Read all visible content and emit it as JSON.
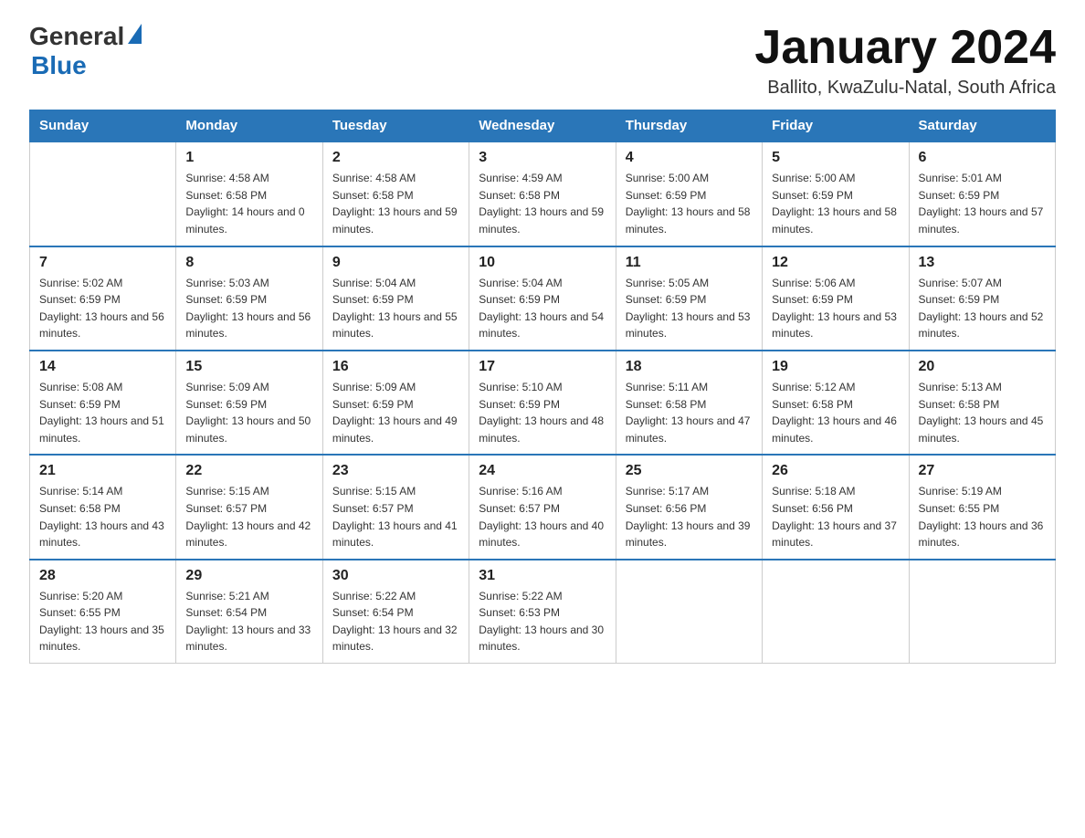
{
  "logo": {
    "general": "General",
    "blue": "Blue"
  },
  "title": "January 2024",
  "location": "Ballito, KwaZulu-Natal, South Africa",
  "days_of_week": [
    "Sunday",
    "Monday",
    "Tuesday",
    "Wednesday",
    "Thursday",
    "Friday",
    "Saturday"
  ],
  "weeks": [
    [
      {
        "day": "",
        "sunrise": "",
        "sunset": "",
        "daylight": ""
      },
      {
        "day": "1",
        "sunrise": "Sunrise: 4:58 AM",
        "sunset": "Sunset: 6:58 PM",
        "daylight": "Daylight: 14 hours and 0 minutes."
      },
      {
        "day": "2",
        "sunrise": "Sunrise: 4:58 AM",
        "sunset": "Sunset: 6:58 PM",
        "daylight": "Daylight: 13 hours and 59 minutes."
      },
      {
        "day": "3",
        "sunrise": "Sunrise: 4:59 AM",
        "sunset": "Sunset: 6:58 PM",
        "daylight": "Daylight: 13 hours and 59 minutes."
      },
      {
        "day": "4",
        "sunrise": "Sunrise: 5:00 AM",
        "sunset": "Sunset: 6:59 PM",
        "daylight": "Daylight: 13 hours and 58 minutes."
      },
      {
        "day": "5",
        "sunrise": "Sunrise: 5:00 AM",
        "sunset": "Sunset: 6:59 PM",
        "daylight": "Daylight: 13 hours and 58 minutes."
      },
      {
        "day": "6",
        "sunrise": "Sunrise: 5:01 AM",
        "sunset": "Sunset: 6:59 PM",
        "daylight": "Daylight: 13 hours and 57 minutes."
      }
    ],
    [
      {
        "day": "7",
        "sunrise": "Sunrise: 5:02 AM",
        "sunset": "Sunset: 6:59 PM",
        "daylight": "Daylight: 13 hours and 56 minutes."
      },
      {
        "day": "8",
        "sunrise": "Sunrise: 5:03 AM",
        "sunset": "Sunset: 6:59 PM",
        "daylight": "Daylight: 13 hours and 56 minutes."
      },
      {
        "day": "9",
        "sunrise": "Sunrise: 5:04 AM",
        "sunset": "Sunset: 6:59 PM",
        "daylight": "Daylight: 13 hours and 55 minutes."
      },
      {
        "day": "10",
        "sunrise": "Sunrise: 5:04 AM",
        "sunset": "Sunset: 6:59 PM",
        "daylight": "Daylight: 13 hours and 54 minutes."
      },
      {
        "day": "11",
        "sunrise": "Sunrise: 5:05 AM",
        "sunset": "Sunset: 6:59 PM",
        "daylight": "Daylight: 13 hours and 53 minutes."
      },
      {
        "day": "12",
        "sunrise": "Sunrise: 5:06 AM",
        "sunset": "Sunset: 6:59 PM",
        "daylight": "Daylight: 13 hours and 53 minutes."
      },
      {
        "day": "13",
        "sunrise": "Sunrise: 5:07 AM",
        "sunset": "Sunset: 6:59 PM",
        "daylight": "Daylight: 13 hours and 52 minutes."
      }
    ],
    [
      {
        "day": "14",
        "sunrise": "Sunrise: 5:08 AM",
        "sunset": "Sunset: 6:59 PM",
        "daylight": "Daylight: 13 hours and 51 minutes."
      },
      {
        "day": "15",
        "sunrise": "Sunrise: 5:09 AM",
        "sunset": "Sunset: 6:59 PM",
        "daylight": "Daylight: 13 hours and 50 minutes."
      },
      {
        "day": "16",
        "sunrise": "Sunrise: 5:09 AM",
        "sunset": "Sunset: 6:59 PM",
        "daylight": "Daylight: 13 hours and 49 minutes."
      },
      {
        "day": "17",
        "sunrise": "Sunrise: 5:10 AM",
        "sunset": "Sunset: 6:59 PM",
        "daylight": "Daylight: 13 hours and 48 minutes."
      },
      {
        "day": "18",
        "sunrise": "Sunrise: 5:11 AM",
        "sunset": "Sunset: 6:58 PM",
        "daylight": "Daylight: 13 hours and 47 minutes."
      },
      {
        "day": "19",
        "sunrise": "Sunrise: 5:12 AM",
        "sunset": "Sunset: 6:58 PM",
        "daylight": "Daylight: 13 hours and 46 minutes."
      },
      {
        "day": "20",
        "sunrise": "Sunrise: 5:13 AM",
        "sunset": "Sunset: 6:58 PM",
        "daylight": "Daylight: 13 hours and 45 minutes."
      }
    ],
    [
      {
        "day": "21",
        "sunrise": "Sunrise: 5:14 AM",
        "sunset": "Sunset: 6:58 PM",
        "daylight": "Daylight: 13 hours and 43 minutes."
      },
      {
        "day": "22",
        "sunrise": "Sunrise: 5:15 AM",
        "sunset": "Sunset: 6:57 PM",
        "daylight": "Daylight: 13 hours and 42 minutes."
      },
      {
        "day": "23",
        "sunrise": "Sunrise: 5:15 AM",
        "sunset": "Sunset: 6:57 PM",
        "daylight": "Daylight: 13 hours and 41 minutes."
      },
      {
        "day": "24",
        "sunrise": "Sunrise: 5:16 AM",
        "sunset": "Sunset: 6:57 PM",
        "daylight": "Daylight: 13 hours and 40 minutes."
      },
      {
        "day": "25",
        "sunrise": "Sunrise: 5:17 AM",
        "sunset": "Sunset: 6:56 PM",
        "daylight": "Daylight: 13 hours and 39 minutes."
      },
      {
        "day": "26",
        "sunrise": "Sunrise: 5:18 AM",
        "sunset": "Sunset: 6:56 PM",
        "daylight": "Daylight: 13 hours and 37 minutes."
      },
      {
        "day": "27",
        "sunrise": "Sunrise: 5:19 AM",
        "sunset": "Sunset: 6:55 PM",
        "daylight": "Daylight: 13 hours and 36 minutes."
      }
    ],
    [
      {
        "day": "28",
        "sunrise": "Sunrise: 5:20 AM",
        "sunset": "Sunset: 6:55 PM",
        "daylight": "Daylight: 13 hours and 35 minutes."
      },
      {
        "day": "29",
        "sunrise": "Sunrise: 5:21 AM",
        "sunset": "Sunset: 6:54 PM",
        "daylight": "Daylight: 13 hours and 33 minutes."
      },
      {
        "day": "30",
        "sunrise": "Sunrise: 5:22 AM",
        "sunset": "Sunset: 6:54 PM",
        "daylight": "Daylight: 13 hours and 32 minutes."
      },
      {
        "day": "31",
        "sunrise": "Sunrise: 5:22 AM",
        "sunset": "Sunset: 6:53 PM",
        "daylight": "Daylight: 13 hours and 30 minutes."
      },
      {
        "day": "",
        "sunrise": "",
        "sunset": "",
        "daylight": ""
      },
      {
        "day": "",
        "sunrise": "",
        "sunset": "",
        "daylight": ""
      },
      {
        "day": "",
        "sunrise": "",
        "sunset": "",
        "daylight": ""
      }
    ]
  ]
}
